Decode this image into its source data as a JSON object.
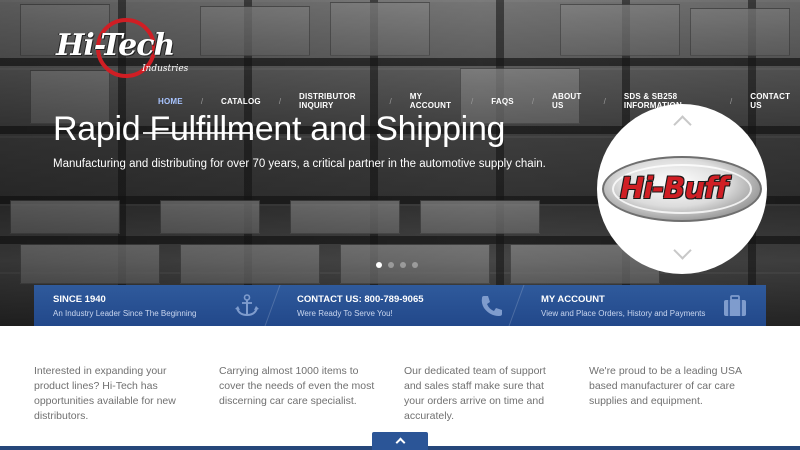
{
  "logo": {
    "name": "Hi-Tech",
    "sub": "Industries"
  },
  "nav": {
    "items": [
      {
        "label": "HOME",
        "active": true
      },
      {
        "label": "CATALOG"
      },
      {
        "label": "DISTRIBUTOR INQUIRY"
      },
      {
        "label": "MY ACCOUNT"
      },
      {
        "label": "FAQS"
      },
      {
        "label": "ABOUT US"
      },
      {
        "label": "SDS & SB258 INFORMATION"
      },
      {
        "label": "CONTACT US"
      }
    ],
    "separator": "/"
  },
  "hero": {
    "headline": "Rapid Fulfillment and Shipping",
    "subline": "Manufacturing and distributing for over 70 years, a critical partner in the automotive supply chain.",
    "slides": 4,
    "active_slide": 1
  },
  "carousel": {
    "brand": "Hi-Buff",
    "up_icon": "chevron-up-icon",
    "down_icon": "chevron-down-icon"
  },
  "info_bar": [
    {
      "title": "SINCE 1940",
      "subtitle": "An Industry Leader Since The Beginning",
      "icon": "anchor-icon"
    },
    {
      "title": "CONTACT US: 800-789-9065",
      "subtitle": "Were Ready To Serve You!",
      "icon": "phone-icon"
    },
    {
      "title": "MY ACCOUNT",
      "subtitle": "View and Place Orders, History and Payments",
      "icon": "briefcase-icon"
    }
  ],
  "features": [
    "Interested in expanding your product lines? Hi-Tech has opportunities available for new distributors.",
    "Carrying almost 1000 items to cover the needs of even the most discerning car care specialist.",
    "Our dedicated team of support and sales staff make sure that your orders arrive on time and accurately.",
    "We're proud to be a leading USA based manufacturer of car care supplies and equipment."
  ],
  "colors": {
    "accent_blue": "#2b5597",
    "info_bar": "#2a5295",
    "brand_red": "#d01e24",
    "text_gray": "#707070"
  }
}
